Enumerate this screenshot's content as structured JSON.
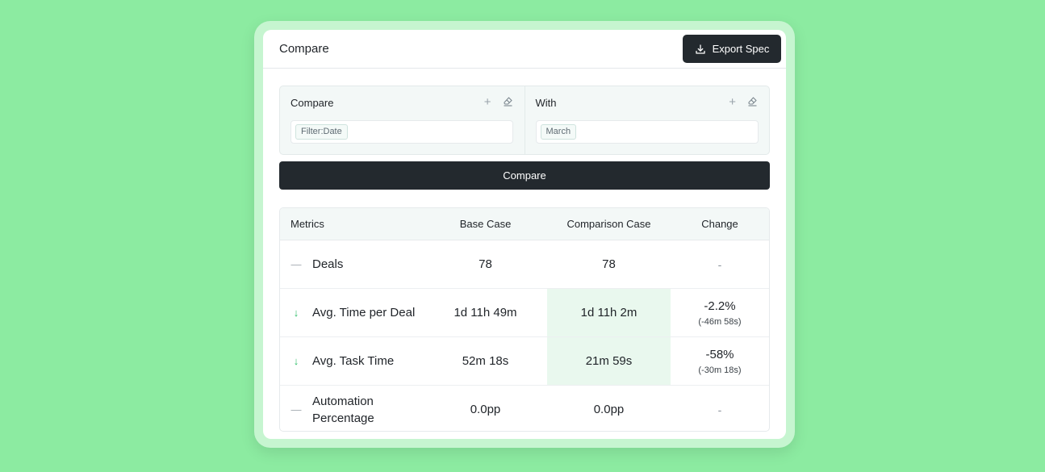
{
  "header": {
    "title": "Compare",
    "export_label": "Export Spec"
  },
  "filters": {
    "compare": {
      "label": "Compare",
      "chip": "Filter:Date"
    },
    "with": {
      "label": "With",
      "chip": "March"
    }
  },
  "compare_button": "Compare",
  "table": {
    "headers": [
      "Metrics",
      "Base Case",
      "Comparison Case",
      "Change"
    ],
    "rows": [
      {
        "icon": "dash-icon",
        "metric": "Deals",
        "base": "78",
        "comparison": "78",
        "change": "-",
        "change_detail": ""
      },
      {
        "icon": "arrow-down-icon",
        "metric": "Avg. Time per Deal",
        "base": "1d 11h 49m",
        "comparison": "1d 11h 2m",
        "change": "-2.2%",
        "change_detail": "(-46m 58s)"
      },
      {
        "icon": "arrow-down-icon",
        "metric": "Avg. Task Time",
        "base": "52m 18s",
        "comparison": "21m 59s",
        "change": "-58%",
        "change_detail": "(-30m 18s)"
      },
      {
        "icon": "dash-icon",
        "metric": "Automation Percentage",
        "base": "0.0pp",
        "comparison": "0.0pp",
        "change": "-",
        "change_detail": ""
      }
    ]
  },
  "colors": {
    "background": "#8ceba1",
    "button_dark": "#23292e",
    "highlight": "#e9f8ee",
    "down_arrow": "#2fbf6a"
  }
}
